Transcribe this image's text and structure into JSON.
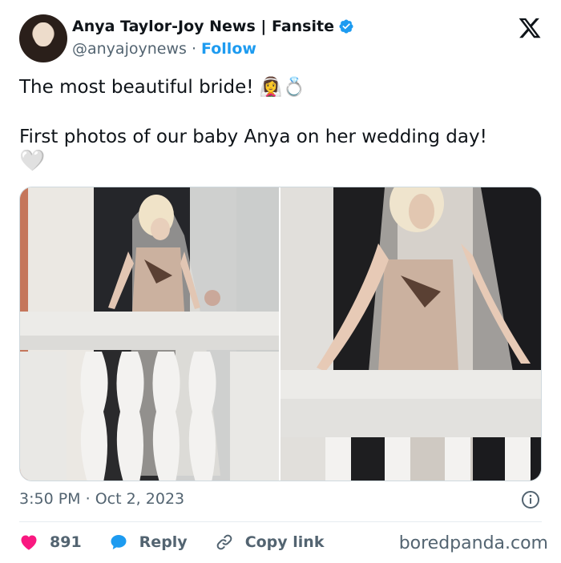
{
  "author": {
    "display_name": "Anya Taylor-Joy News | Fansite",
    "handle": "@anyajoynews",
    "separator": "·",
    "follow_label": "Follow"
  },
  "tweet": {
    "line1": "The most beautiful bride! 👰‍♀️💍",
    "line2": "First photos of our baby Anya on her wedding day!",
    "line3": "🤍"
  },
  "meta": {
    "time": "3:50 PM",
    "separator": "·",
    "date": "Oct 2, 2023"
  },
  "actions": {
    "like_count": "891",
    "reply_label": "Reply",
    "copy_label": "Copy link"
  },
  "watermark": "boredpanda.com",
  "icons": {
    "verified": "verified-badge-icon",
    "x_logo": "x-logo-icon",
    "info": "info-icon",
    "heart": "heart-icon",
    "reply": "reply-bubble-icon",
    "link": "link-icon"
  },
  "colors": {
    "accent": "#1d9bf0",
    "like": "#f91880",
    "muted": "#536471"
  }
}
